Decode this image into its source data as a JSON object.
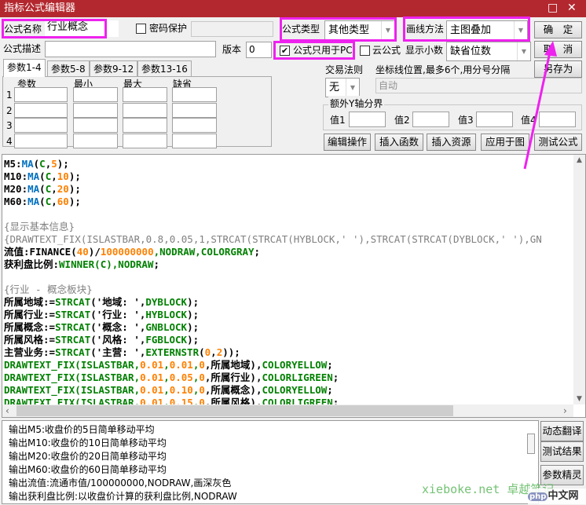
{
  "window": {
    "title": "指标公式编辑器",
    "maximize_icon": "□",
    "close_icon": "✕"
  },
  "form": {
    "name_label": "公式名称",
    "name_value": "行业概念",
    "password_label": "密码保护",
    "password_checked": false,
    "type_label": "公式类型",
    "type_value": "其他类型",
    "draw_label": "画线方法",
    "draw_value": "主图叠加",
    "desc_label": "公式描述",
    "desc_value": "",
    "version_label": "版本",
    "version_value": "0",
    "pc_only_label": "公式只用于PC",
    "pc_only_checked": true,
    "cloud_label": "云公式",
    "cloud_checked": false,
    "decimal_label": "显示小数",
    "decimal_value": "缺省位数",
    "trade_label": "交易法则",
    "trade_value": "无",
    "coord_label": "坐标线位置,最多6个,用分号分隔",
    "coord_value": "自动",
    "yaxis_group": "额外Y轴分界",
    "yaxis_values": [
      "值1",
      "值2",
      "值3",
      "值4"
    ]
  },
  "buttons": {
    "ok": "确　定",
    "cancel": "取　消",
    "save_as": "另存为",
    "edit_ops": "编辑操作",
    "insert_func": "插入函数",
    "insert_res": "插入资源",
    "apply": "应用于图",
    "test": "测试公式",
    "translate": "动态翻译",
    "test_result": "测试结果",
    "param_wizard": "参数精灵"
  },
  "tabs": [
    "参数1-4",
    "参数5-8",
    "参数9-12",
    "参数13-16"
  ],
  "params": {
    "headers": [
      "参数",
      "最小",
      "最大",
      "缺省"
    ],
    "rows": [
      "1",
      "2",
      "3",
      "4"
    ]
  },
  "colors": {
    "k": "#000000",
    "b": "#0070c0",
    "o": "#ff8000",
    "g": "#008000",
    "c": "#808080",
    "title": "#b3282e",
    "highlight": "#ee22ee"
  },
  "code": [
    [
      [
        "M5:",
        "k"
      ],
      [
        "MA",
        "b"
      ],
      [
        "(",
        "k"
      ],
      [
        "C",
        "g"
      ],
      [
        ",",
        "k"
      ],
      [
        "5",
        "o"
      ],
      [
        ");",
        "k"
      ]
    ],
    [
      [
        "M10:",
        "k"
      ],
      [
        "MA",
        "b"
      ],
      [
        "(",
        "k"
      ],
      [
        "C",
        "g"
      ],
      [
        ",",
        "k"
      ],
      [
        "10",
        "o"
      ],
      [
        ");",
        "k"
      ]
    ],
    [
      [
        "M20:",
        "k"
      ],
      [
        "MA",
        "b"
      ],
      [
        "(",
        "k"
      ],
      [
        "C",
        "g"
      ],
      [
        ",",
        "k"
      ],
      [
        "20",
        "o"
      ],
      [
        ");",
        "k"
      ]
    ],
    [
      [
        "M60:",
        "k"
      ],
      [
        "MA",
        "b"
      ],
      [
        "(",
        "k"
      ],
      [
        "C",
        "g"
      ],
      [
        ",",
        "k"
      ],
      [
        "60",
        "o"
      ],
      [
        ");",
        "k"
      ]
    ],
    [],
    [
      [
        "{显示基本信息}",
        "c"
      ]
    ],
    [
      [
        "{DRAWTEXT_FIX(ISLASTBAR,0.8,0.05,1,STRCAT(STRCAT(HYBLOCK,' '),STRCAT(STRCAT(DYBLOCK,' '),GN",
        "c"
      ]
    ],
    [
      [
        "流值:FINANCE(",
        "k"
      ],
      [
        "40",
        "o"
      ],
      [
        ")/",
        "k"
      ],
      [
        "100000000",
        "o"
      ],
      [
        ",NODRAW,COLORGRAY",
        "g"
      ],
      [
        ";",
        "k"
      ]
    ],
    [
      [
        "获利盘比例:",
        "k"
      ],
      [
        "WINNER(C),NODRAW",
        "g"
      ],
      [
        ";",
        "k"
      ]
    ],
    [],
    [
      [
        "{行业 - 概念板块}",
        "c"
      ]
    ],
    [
      [
        "所属地域:=",
        "k"
      ],
      [
        "STRCAT",
        "g"
      ],
      [
        "('地域: ',",
        "k"
      ],
      [
        "DYBLOCK",
        "g"
      ],
      [
        ");",
        "k"
      ]
    ],
    [
      [
        "所属行业:=",
        "k"
      ],
      [
        "STRCAT",
        "g"
      ],
      [
        "('行业: ',",
        "k"
      ],
      [
        "HYBLOCK",
        "g"
      ],
      [
        ");",
        "k"
      ]
    ],
    [
      [
        "所属概念:=",
        "k"
      ],
      [
        "STRCAT",
        "g"
      ],
      [
        "('概念: ',",
        "k"
      ],
      [
        "GNBLOCK",
        "g"
      ],
      [
        ");",
        "k"
      ]
    ],
    [
      [
        "所属风格:=",
        "k"
      ],
      [
        "STRCAT",
        "g"
      ],
      [
        "('风格: ',",
        "k"
      ],
      [
        "FGBLOCK",
        "g"
      ],
      [
        ");",
        "k"
      ]
    ],
    [
      [
        "主营业务:=",
        "k"
      ],
      [
        "STRCAT",
        "g"
      ],
      [
        "('主营: ',",
        "k"
      ],
      [
        "EXTERNSTR",
        "g"
      ],
      [
        "(",
        "k"
      ],
      [
        "0",
        "o"
      ],
      [
        ",",
        "k"
      ],
      [
        "2",
        "o"
      ],
      [
        "));",
        "k"
      ]
    ],
    [
      [
        "DRAWTEXT_FIX(ISLASTBAR,",
        "g"
      ],
      [
        "0.01",
        "o"
      ],
      [
        ",",
        "g"
      ],
      [
        "0.01",
        "o"
      ],
      [
        ",",
        "g"
      ],
      [
        "0",
        "o"
      ],
      [
        ",所属地域),",
        "k"
      ],
      [
        "COLORYELLOW",
        "g"
      ],
      [
        ";",
        "k"
      ]
    ],
    [
      [
        "DRAWTEXT_FIX(ISLASTBAR,",
        "g"
      ],
      [
        "0.01",
        "o"
      ],
      [
        ",",
        "g"
      ],
      [
        "0.05",
        "o"
      ],
      [
        ",",
        "g"
      ],
      [
        "0",
        "o"
      ],
      [
        ",所属行业),",
        "k"
      ],
      [
        "COLORLIGREEN",
        "g"
      ],
      [
        ";",
        "k"
      ]
    ],
    [
      [
        "DRAWTEXT_FIX(ISLASTBAR,",
        "g"
      ],
      [
        "0.01",
        "o"
      ],
      [
        ",",
        "g"
      ],
      [
        "0.10",
        "o"
      ],
      [
        ",",
        "g"
      ],
      [
        "0",
        "o"
      ],
      [
        ",所属概念),",
        "k"
      ],
      [
        "COLORYELLOW",
        "g"
      ],
      [
        ";",
        "k"
      ]
    ],
    [
      [
        "DRAWTEXT_FIX(ISLASTBAR,",
        "g"
      ],
      [
        "0.01",
        "o"
      ],
      [
        ",",
        "g"
      ],
      [
        "0.15",
        "o"
      ],
      [
        ",",
        "g"
      ],
      [
        "0",
        "o"
      ],
      [
        ",所属风格),",
        "k"
      ],
      [
        "COLORLIGREEN",
        "g"
      ],
      [
        ";",
        "k"
      ]
    ]
  ],
  "output": [
    "输出M5:收盘价的5日简单移动平均",
    "输出M10:收盘价的10日简单移动平均",
    "输出M20:收盘价的20日简单移动平均",
    "输出M60:收盘价的60日简单移动平均",
    "输出流值:流通市值/100000000,NODRAW,画深灰色",
    "输出获利盘比例:以收盘价计算的获利盘比例,NODRAW"
  ],
  "watermark": "xieboke.net 卓越笔记",
  "logo": "php中文网"
}
